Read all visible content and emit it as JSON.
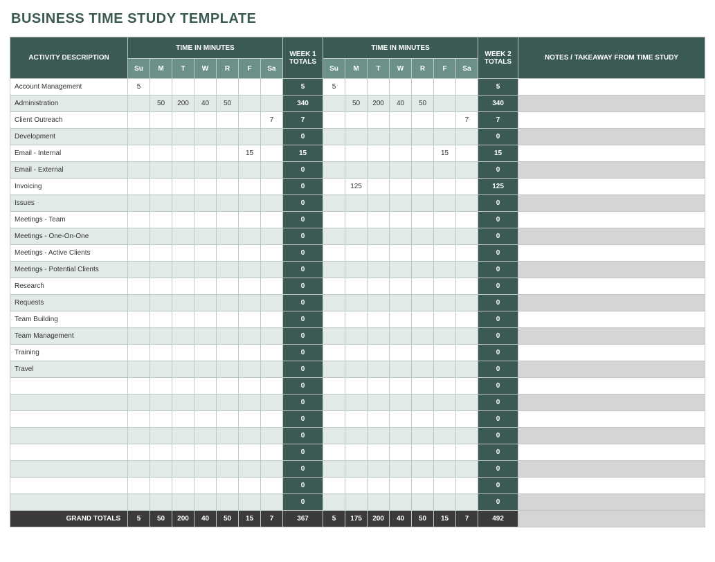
{
  "title": "BUSINESS TIME STUDY TEMPLATE",
  "headers": {
    "activity": "ACTIVITY DESCRIPTION",
    "timeInMinutes": "TIME IN MINUTES",
    "week1Totals": "WEEK 1 TOTALS",
    "week2Totals": "WEEK 2 TOTALS",
    "notes": "NOTES / TAKEAWAY FROM TIME STUDY",
    "days": [
      "Su",
      "M",
      "T",
      "W",
      "R",
      "F",
      "Sa"
    ],
    "grandTotals": "GRAND TOTALS"
  },
  "rows": [
    {
      "label": "Account Management",
      "w1": [
        "5",
        "",
        "",
        "",
        "",
        "",
        ""
      ],
      "t1": "5",
      "w2": [
        "5",
        "",
        "",
        "",
        "",
        "",
        ""
      ],
      "t2": "5"
    },
    {
      "label": "Administration",
      "w1": [
        "",
        "50",
        "200",
        "40",
        "50",
        "",
        ""
      ],
      "t1": "340",
      "w2": [
        "",
        "50",
        "200",
        "40",
        "50",
        "",
        ""
      ],
      "t2": "340"
    },
    {
      "label": "Client Outreach",
      "w1": [
        "",
        "",
        "",
        "",
        "",
        "",
        "7"
      ],
      "t1": "7",
      "w2": [
        "",
        "",
        "",
        "",
        "",
        "",
        "7"
      ],
      "t2": "7"
    },
    {
      "label": "Development",
      "w1": [
        "",
        "",
        "",
        "",
        "",
        "",
        ""
      ],
      "t1": "0",
      "w2": [
        "",
        "",
        "",
        "",
        "",
        "",
        ""
      ],
      "t2": "0"
    },
    {
      "label": "Email - Internal",
      "w1": [
        "",
        "",
        "",
        "",
        "",
        "15",
        ""
      ],
      "t1": "15",
      "w2": [
        "",
        "",
        "",
        "",
        "",
        "15",
        ""
      ],
      "t2": "15"
    },
    {
      "label": "Email - External",
      "w1": [
        "",
        "",
        "",
        "",
        "",
        "",
        ""
      ],
      "t1": "0",
      "w2": [
        "",
        "",
        "",
        "",
        "",
        "",
        ""
      ],
      "t2": "0"
    },
    {
      "label": "Invoicing",
      "w1": [
        "",
        "",
        "",
        "",
        "",
        "",
        ""
      ],
      "t1": "0",
      "w2": [
        "",
        "125",
        "",
        "",
        "",
        "",
        ""
      ],
      "t2": "125"
    },
    {
      "label": "Issues",
      "w1": [
        "",
        "",
        "",
        "",
        "",
        "",
        ""
      ],
      "t1": "0",
      "w2": [
        "",
        "",
        "",
        "",
        "",
        "",
        ""
      ],
      "t2": "0"
    },
    {
      "label": "Meetings - Team",
      "w1": [
        "",
        "",
        "",
        "",
        "",
        "",
        ""
      ],
      "t1": "0",
      "w2": [
        "",
        "",
        "",
        "",
        "",
        "",
        ""
      ],
      "t2": "0"
    },
    {
      "label": "Meetings - One-On-One",
      "w1": [
        "",
        "",
        "",
        "",
        "",
        "",
        ""
      ],
      "t1": "0",
      "w2": [
        "",
        "",
        "",
        "",
        "",
        "",
        ""
      ],
      "t2": "0"
    },
    {
      "label": "Meetings - Active Clients",
      "w1": [
        "",
        "",
        "",
        "",
        "",
        "",
        ""
      ],
      "t1": "0",
      "w2": [
        "",
        "",
        "",
        "",
        "",
        "",
        ""
      ],
      "t2": "0"
    },
    {
      "label": "Meetings - Potential Clients",
      "w1": [
        "",
        "",
        "",
        "",
        "",
        "",
        ""
      ],
      "t1": "0",
      "w2": [
        "",
        "",
        "",
        "",
        "",
        "",
        ""
      ],
      "t2": "0"
    },
    {
      "label": "Research",
      "w1": [
        "",
        "",
        "",
        "",
        "",
        "",
        ""
      ],
      "t1": "0",
      "w2": [
        "",
        "",
        "",
        "",
        "",
        "",
        ""
      ],
      "t2": "0"
    },
    {
      "label": "Requests",
      "w1": [
        "",
        "",
        "",
        "",
        "",
        "",
        ""
      ],
      "t1": "0",
      "w2": [
        "",
        "",
        "",
        "",
        "",
        "",
        ""
      ],
      "t2": "0"
    },
    {
      "label": "Team Building",
      "w1": [
        "",
        "",
        "",
        "",
        "",
        "",
        ""
      ],
      "t1": "0",
      "w2": [
        "",
        "",
        "",
        "",
        "",
        "",
        ""
      ],
      "t2": "0"
    },
    {
      "label": "Team Management",
      "w1": [
        "",
        "",
        "",
        "",
        "",
        "",
        ""
      ],
      "t1": "0",
      "w2": [
        "",
        "",
        "",
        "",
        "",
        "",
        ""
      ],
      "t2": "0"
    },
    {
      "label": "Training",
      "w1": [
        "",
        "",
        "",
        "",
        "",
        "",
        ""
      ],
      "t1": "0",
      "w2": [
        "",
        "",
        "",
        "",
        "",
        "",
        ""
      ],
      "t2": "0"
    },
    {
      "label": "Travel",
      "w1": [
        "",
        "",
        "",
        "",
        "",
        "",
        ""
      ],
      "t1": "0",
      "w2": [
        "",
        "",
        "",
        "",
        "",
        "",
        ""
      ],
      "t2": "0"
    },
    {
      "label": "",
      "w1": [
        "",
        "",
        "",
        "",
        "",
        "",
        ""
      ],
      "t1": "0",
      "w2": [
        "",
        "",
        "",
        "",
        "",
        "",
        ""
      ],
      "t2": "0"
    },
    {
      "label": "",
      "w1": [
        "",
        "",
        "",
        "",
        "",
        "",
        ""
      ],
      "t1": "0",
      "w2": [
        "",
        "",
        "",
        "",
        "",
        "",
        ""
      ],
      "t2": "0"
    },
    {
      "label": "",
      "w1": [
        "",
        "",
        "",
        "",
        "",
        "",
        ""
      ],
      "t1": "0",
      "w2": [
        "",
        "",
        "",
        "",
        "",
        "",
        ""
      ],
      "t2": "0"
    },
    {
      "label": "",
      "w1": [
        "",
        "",
        "",
        "",
        "",
        "",
        ""
      ],
      "t1": "0",
      "w2": [
        "",
        "",
        "",
        "",
        "",
        "",
        ""
      ],
      "t2": "0"
    },
    {
      "label": "",
      "w1": [
        "",
        "",
        "",
        "",
        "",
        "",
        ""
      ],
      "t1": "0",
      "w2": [
        "",
        "",
        "",
        "",
        "",
        "",
        ""
      ],
      "t2": "0"
    },
    {
      "label": "",
      "w1": [
        "",
        "",
        "",
        "",
        "",
        "",
        ""
      ],
      "t1": "0",
      "w2": [
        "",
        "",
        "",
        "",
        "",
        "",
        ""
      ],
      "t2": "0"
    },
    {
      "label": "",
      "w1": [
        "",
        "",
        "",
        "",
        "",
        "",
        ""
      ],
      "t1": "0",
      "w2": [
        "",
        "",
        "",
        "",
        "",
        "",
        ""
      ],
      "t2": "0"
    },
    {
      "label": "",
      "w1": [
        "",
        "",
        "",
        "",
        "",
        "",
        ""
      ],
      "t1": "0",
      "w2": [
        "",
        "",
        "",
        "",
        "",
        "",
        ""
      ],
      "t2": "0"
    }
  ],
  "grand": {
    "w1": [
      "5",
      "50",
      "200",
      "40",
      "50",
      "15",
      "7"
    ],
    "t1": "367",
    "w2": [
      "5",
      "175",
      "200",
      "40",
      "50",
      "15",
      "7"
    ],
    "t2": "492"
  }
}
